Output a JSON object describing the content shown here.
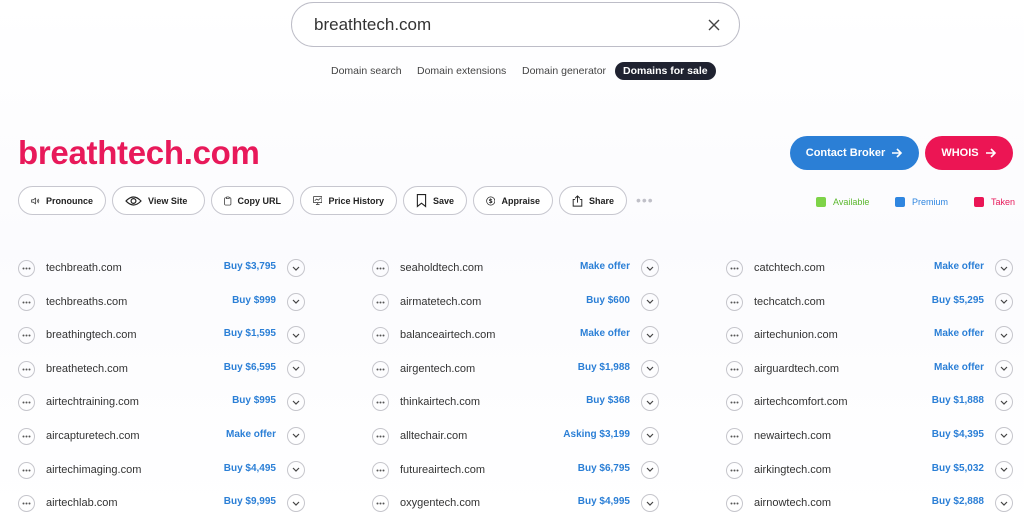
{
  "search": {
    "value": "breathtech.com"
  },
  "tabs": [
    {
      "label": "Domain search"
    },
    {
      "label": "Domain extensions"
    },
    {
      "label": "Domain generator"
    },
    {
      "label": "Domains for sale"
    }
  ],
  "domain": {
    "title": "breathtech.com"
  },
  "header_buttons": {
    "contact_broker": "Contact Broker",
    "whois": "WHOIS"
  },
  "actions": [
    {
      "label": "Pronounce",
      "icon": "speaker-icon"
    },
    {
      "label": "View Site",
      "icon": "eye-icon"
    },
    {
      "label": "Copy URL",
      "icon": "clipboard-icon"
    },
    {
      "label": "Price History",
      "icon": "chart-icon"
    },
    {
      "label": "Save",
      "icon": "bookmark-icon"
    },
    {
      "label": "Appraise",
      "icon": "dollar-icon"
    },
    {
      "label": "Share",
      "icon": "share-icon"
    }
  ],
  "legend": [
    {
      "label": "Available",
      "color": "#7ed348"
    },
    {
      "label": "Premium",
      "color": "#2f86e0"
    },
    {
      "label": "Taken",
      "color": "#ea1656"
    }
  ],
  "colors": {
    "accent": "#e8195a",
    "price": "#2b7fd6",
    "broker": "#2b7fd6",
    "whois": "#ec1554"
  },
  "columns": [
    [
      {
        "name": "techbreath.com",
        "price": "Buy $3,795"
      },
      {
        "name": "techbreaths.com",
        "price": "Buy $999"
      },
      {
        "name": "breathingtech.com",
        "price": "Buy $1,595"
      },
      {
        "name": "breathetech.com",
        "price": "Buy $6,595"
      },
      {
        "name": "airtechtraining.com",
        "price": "Buy $995"
      },
      {
        "name": "aircapturetech.com",
        "price": "Make offer"
      },
      {
        "name": "airtechimaging.com",
        "price": "Buy $4,495"
      },
      {
        "name": "airtechlab.com",
        "price": "Buy $9,995"
      }
    ],
    [
      {
        "name": "seaholdtech.com",
        "price": "Make offer"
      },
      {
        "name": "airmatetech.com",
        "price": "Buy $600"
      },
      {
        "name": "balanceairtech.com",
        "price": "Make offer"
      },
      {
        "name": "airgentech.com",
        "price": "Buy $1,988"
      },
      {
        "name": "thinkairtech.com",
        "price": "Buy $368"
      },
      {
        "name": "alltechair.com",
        "price": "Asking $3,199"
      },
      {
        "name": "futureairtech.com",
        "price": "Buy $6,795"
      },
      {
        "name": "oxygentech.com",
        "price": "Buy $4,995"
      }
    ],
    [
      {
        "name": "catchtech.com",
        "price": "Make offer"
      },
      {
        "name": "techcatch.com",
        "price": "Buy $5,295"
      },
      {
        "name": "airtechunion.com",
        "price": "Make offer"
      },
      {
        "name": "airguardtech.com",
        "price": "Make offer"
      },
      {
        "name": "airtechcomfort.com",
        "price": "Buy $1,888"
      },
      {
        "name": "newairtech.com",
        "price": "Buy $4,395"
      },
      {
        "name": "airkingtech.com",
        "price": "Buy $5,032"
      },
      {
        "name": "airnowtech.com",
        "price": "Buy $2,888"
      }
    ]
  ]
}
